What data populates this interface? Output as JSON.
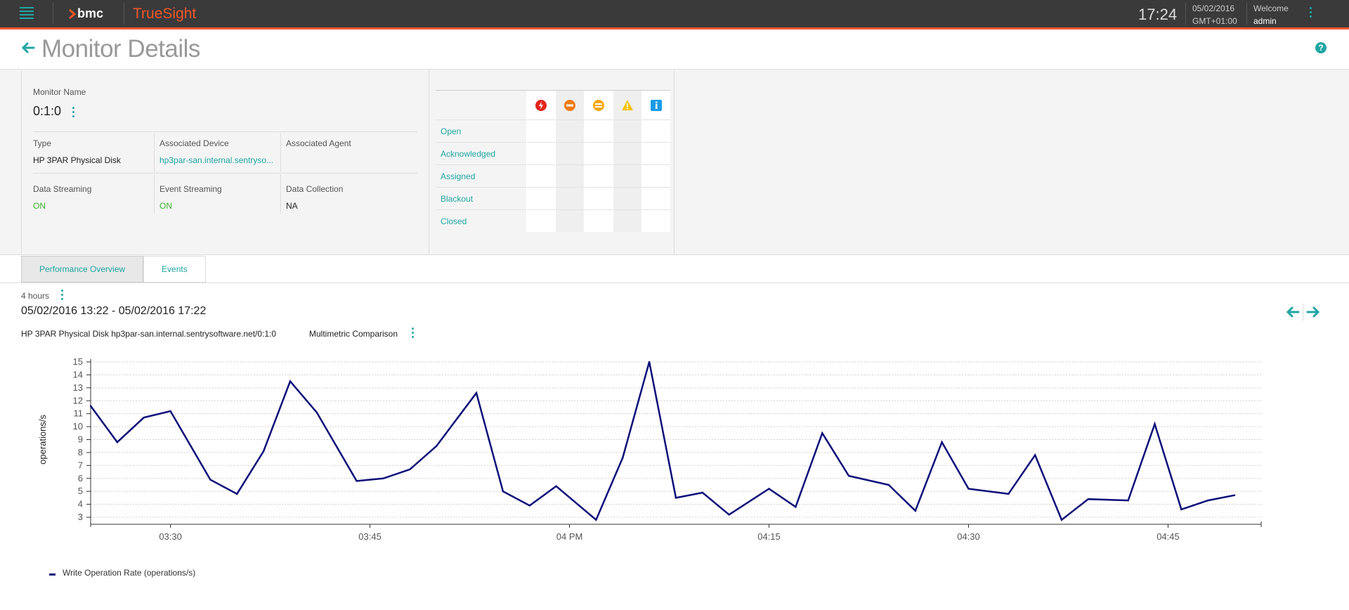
{
  "topbar": {
    "brand": "bmc",
    "product": "TrueSight",
    "time": "17:24",
    "date": "05/02/2016",
    "timezone": "GMT+01:00",
    "welcome": "Welcome",
    "user": "admin"
  },
  "page": {
    "title": "Monitor Details"
  },
  "monitor": {
    "name_label": "Monitor Name",
    "name": "0:1:0",
    "type_label": "Type",
    "type": "HP 3PAR Physical Disk",
    "device_label": "Associated Device",
    "device": "hp3par-san.internal.sentryso...",
    "agent_label": "Associated Agent",
    "agent": "",
    "data_streaming_label": "Data Streaming",
    "data_streaming": "ON",
    "event_streaming_label": "Event Streaming",
    "event_streaming": "ON",
    "data_collection_label": "Data Collection",
    "data_collection": "NA"
  },
  "events": {
    "severity_icons": [
      "critical-icon",
      "major-icon",
      "minor-icon",
      "warning-icon",
      "info-icon"
    ],
    "rows": [
      "Open",
      "Acknowledged",
      "Assigned",
      "Blackout",
      "Closed"
    ]
  },
  "tabs": [
    "Performance Overview",
    "Events"
  ],
  "range": {
    "label": "4 hours",
    "dates": "05/02/2016 13:22 - 05/02/2016 17:22"
  },
  "chart_header": {
    "subject": "HP 3PAR Physical Disk hp3par-san.internal.sentrysoftware.net/0:1:0",
    "comparison": "Multimetric Comparison"
  },
  "chart_data": {
    "type": "line",
    "title": "",
    "ylabel": "operations/s",
    "xlabel": "",
    "ylim": [
      3,
      15
    ],
    "yticks": [
      3,
      4,
      5,
      6,
      7,
      8,
      9,
      10,
      11,
      12,
      13,
      14,
      15
    ],
    "xlim": [
      "03:24",
      "04:52"
    ],
    "xticks": [
      {
        "t": "03:30",
        "label": "03:30"
      },
      {
        "t": "03:45",
        "label": "03:45"
      },
      {
        "t": "04:00",
        "label": "04 PM"
      },
      {
        "t": "04:15",
        "label": "04:15"
      },
      {
        "t": "04:30",
        "label": "04:30"
      },
      {
        "t": "04:45",
        "label": "04:45"
      }
    ],
    "grid": true,
    "series": [
      {
        "name": "Write Operation Rate (operations/s)",
        "color": "#0d0d7a",
        "points": [
          [
            "03:24",
            11.6
          ],
          [
            "03:26",
            8.8
          ],
          [
            "03:28",
            10.7
          ],
          [
            "03:30",
            11.2
          ],
          [
            "03:33",
            5.9
          ],
          [
            "03:35",
            4.8
          ],
          [
            "03:37",
            8.1
          ],
          [
            "03:39",
            13.5
          ],
          [
            "03:41",
            11.1
          ],
          [
            "03:44",
            5.8
          ],
          [
            "03:46",
            6.0
          ],
          [
            "03:48",
            6.7
          ],
          [
            "03:50",
            8.5
          ],
          [
            "03:53",
            12.6
          ],
          [
            "03:55",
            5.0
          ],
          [
            "03:57",
            3.9
          ],
          [
            "03:59",
            5.4
          ],
          [
            "04:02",
            2.8
          ],
          [
            "04:04",
            7.6
          ],
          [
            "04:06",
            15.0
          ],
          [
            "04:08",
            4.5
          ],
          [
            "04:10",
            4.9
          ],
          [
            "04:12",
            3.2
          ],
          [
            "04:15",
            5.2
          ],
          [
            "04:17",
            3.8
          ],
          [
            "04:19",
            9.5
          ],
          [
            "04:21",
            6.2
          ],
          [
            "04:24",
            5.5
          ],
          [
            "04:26",
            3.5
          ],
          [
            "04:28",
            8.8
          ],
          [
            "04:30",
            5.2
          ],
          [
            "04:33",
            4.8
          ],
          [
            "04:35",
            7.8
          ],
          [
            "04:37",
            2.8
          ],
          [
            "04:39",
            4.4
          ],
          [
            "04:42",
            4.3
          ],
          [
            "04:44",
            10.2
          ],
          [
            "04:46",
            3.6
          ],
          [
            "04:48",
            4.3
          ],
          [
            "04:50",
            4.7
          ]
        ]
      }
    ],
    "legend_position": "bottom-left"
  }
}
